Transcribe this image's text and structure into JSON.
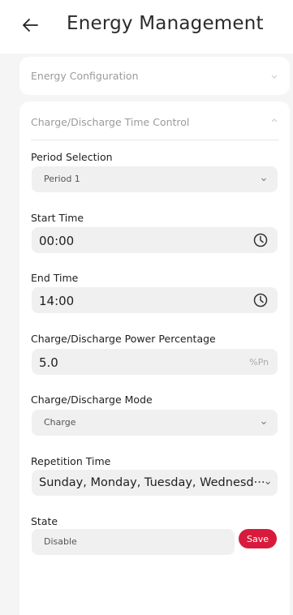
{
  "header": {
    "title": "Energy Management"
  },
  "config_section": {
    "title": "Energy Configuration"
  },
  "control_section": {
    "title": "Charge/Discharge Time Control",
    "period": {
      "label": "Period Selection",
      "value": "Period 1"
    },
    "start_time": {
      "label": "Start Time",
      "value": "00:00"
    },
    "end_time": {
      "label": "End Time",
      "value": "14:00"
    },
    "power": {
      "label": "Charge/Discharge Power Percentage",
      "value": "5.0",
      "unit": "%Pn"
    },
    "mode": {
      "label": "Charge/Discharge Mode",
      "value": "Charge"
    },
    "repetition": {
      "label": "Repetition Time",
      "value": "Sunday, Monday, Tuesday, Wednesd···"
    },
    "state": {
      "label": "State",
      "value": "Disable"
    },
    "save_label": "Save"
  },
  "colors": {
    "accent": "#d81b3c",
    "field_bg": "#f0f0f0",
    "page_bg": "#f5f5f5"
  },
  "icons": [
    "back-arrow-icon",
    "chevron-down-icon",
    "chevron-up-icon",
    "clock-icon"
  ]
}
